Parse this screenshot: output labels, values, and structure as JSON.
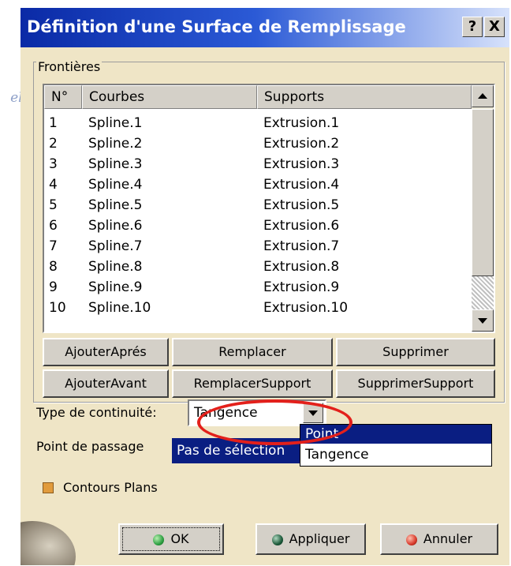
{
  "stray_text": "eli",
  "window": {
    "title": "Définition d'une Surface de Remplissage",
    "help_label": "?",
    "close_label": "X"
  },
  "frontieres": {
    "group_label": "Frontières",
    "columns": [
      "N°",
      "Courbes",
      "Supports"
    ],
    "rows": [
      {
        "n": "1",
        "courbe": "Spline.1",
        "support": "Extrusion.1"
      },
      {
        "n": "2",
        "courbe": "Spline.2",
        "support": "Extrusion.2"
      },
      {
        "n": "3",
        "courbe": "Spline.3",
        "support": "Extrusion.3"
      },
      {
        "n": "4",
        "courbe": "Spline.4",
        "support": "Extrusion.4"
      },
      {
        "n": "5",
        "courbe": "Spline.5",
        "support": "Extrusion.5"
      },
      {
        "n": "6",
        "courbe": "Spline.6",
        "support": "Extrusion.6"
      },
      {
        "n": "7",
        "courbe": "Spline.7",
        "support": "Extrusion.7"
      },
      {
        "n": "8",
        "courbe": "Spline.8",
        "support": "Extrusion.8"
      },
      {
        "n": "9",
        "courbe": "Spline.9",
        "support": "Extrusion.9"
      },
      {
        "n": "10",
        "courbe": "Spline.10",
        "support": "Extrusion.10"
      }
    ]
  },
  "buttons": {
    "ajouter_apres": "AjouterAprés",
    "remplacer": "Remplacer",
    "supprimer": "Supprimer",
    "ajouter_avant": "AjouterAvant",
    "remplacer_support": "RemplacerSupport",
    "supprimer_support": "SupprimerSupport"
  },
  "continuite": {
    "label": "Type de continuité:",
    "value": "Tangence",
    "options": [
      "Point",
      "Tangence"
    ],
    "highlighted_option": "Point"
  },
  "passage": {
    "label": "Point de passage",
    "value": "Pas de sélection"
  },
  "contours": {
    "label": "Contours Plans",
    "checked": false
  },
  "actions": {
    "ok": "OK",
    "appliquer": "Appliquer",
    "annuler": "Annuler"
  },
  "colors": {
    "title_bar": "#0a2aa6",
    "dialog_bg": "#efe5c6",
    "selection": "#0a1e82",
    "annotation_ring": "#e3201b",
    "ok_icon": "#2ea043",
    "apply_icon": "#1c5a3a",
    "cancel_icon": "#d93a2b"
  }
}
